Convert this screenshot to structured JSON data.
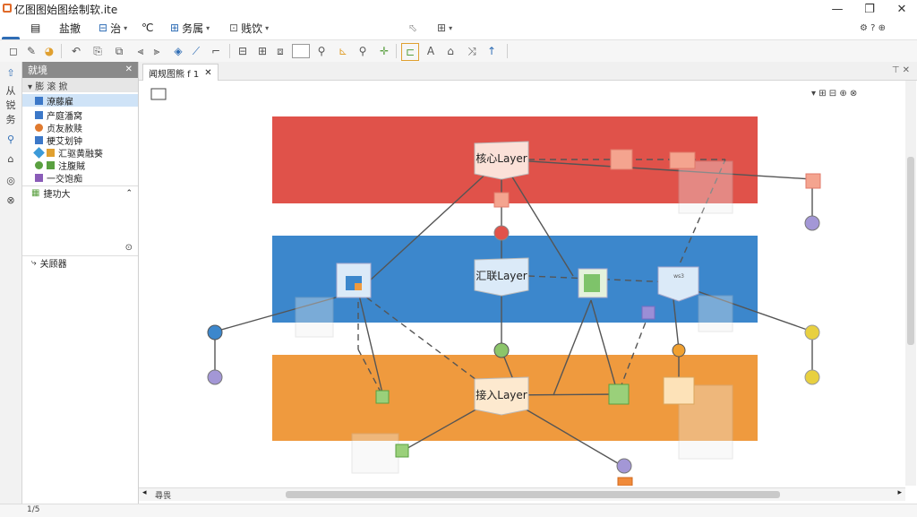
{
  "window": {
    "title": "亿图图始图绘制软.ite",
    "controls": {
      "minimize": "—",
      "maximize": "❐",
      "close": "✕"
    }
  },
  "menu": {
    "home_label": "亿",
    "items": [
      {
        "label": "巨"
      },
      {
        "label": "盐撤"
      },
      {
        "label": "治",
        "caret": "▾"
      },
      {
        "label": "℃"
      },
      {
        "label": "务属",
        "caret": "▾"
      },
      {
        "label": "贱饮",
        "caret": "▾"
      }
    ],
    "right_tools": {
      "quick": "⬁",
      "layout": "⊞",
      "caret": "▾",
      "settings": "⚙ ? ⊕"
    }
  },
  "sidebar": {
    "header": "就境",
    "tools": "▾ 膨  滚  掀",
    "items": [
      {
        "label": "潦藤雇",
        "color": "#3c78c8"
      },
      {
        "label": "产庭潘窝",
        "color": "#3c78c8"
      },
      {
        "label": "贞友赦赎",
        "color": "#e07a2f"
      },
      {
        "label": "梗艾划钟",
        "color": "#3c78c8"
      },
      {
        "label": "汇驱黄融葵",
        "color": "#e0a030"
      },
      {
        "label": "注腹賊",
        "color": "#5aa040"
      },
      {
        "label": "一交饱痴",
        "color": "#8a5cb8"
      }
    ],
    "section1": "捷功大",
    "section2": "关顾器",
    "footer": "1/5"
  },
  "left_strip": [
    "⇧",
    "从",
    "锐",
    "务",
    "⚲",
    "⌂",
    "◎",
    "⊗"
  ],
  "document": {
    "tab_label": "闻规图熊 f 1",
    "tab_close": "✕"
  },
  "diagram": {
    "layers": [
      {
        "label": "核心Layer",
        "color": "#e0524a"
      },
      {
        "label": "汇联Layer",
        "color": "#3c87cc"
      },
      {
        "label": "接入Layer",
        "color": "#ef9a3e"
      }
    ],
    "node_label": "ws3"
  },
  "hscroll": {
    "label": "尋畏"
  },
  "status": {
    "text": "1/5"
  },
  "colors": {
    "accent": "#2f6db5",
    "core": "#e0524a",
    "aggregation": "#3c87cc",
    "access": "#ef9a3e"
  }
}
